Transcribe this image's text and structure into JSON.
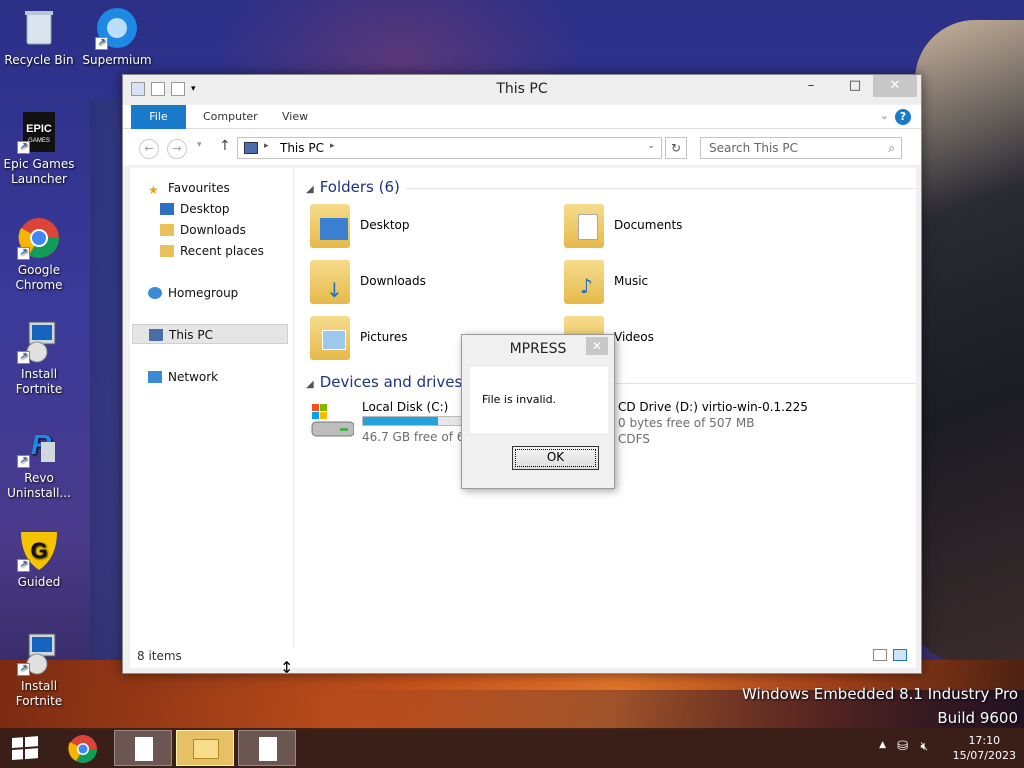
{
  "desktop": {
    "icons": [
      {
        "label": "Recycle Bin",
        "icon": "recycle-bin-icon"
      },
      {
        "label": "Supermium",
        "icon": "supermium-icon"
      },
      {
        "label": "Epic Games Launcher",
        "icon": "epic-games-icon"
      },
      {
        "label": "Google Chrome",
        "icon": "chrome-icon"
      },
      {
        "label": "Install Fortnite",
        "icon": "installer-icon"
      },
      {
        "label": "Revo Uninstall...",
        "icon": "revo-icon"
      },
      {
        "label": "Guided",
        "icon": "guilded-icon"
      },
      {
        "label": "Install Fortnite",
        "icon": "installer-icon"
      }
    ],
    "watermark_line1": "Windows Embedded 8.1 Industry Pro",
    "watermark_line2": "Build 9600"
  },
  "window": {
    "title": "This PC",
    "ribbon_tabs": [
      "File",
      "Computer",
      "View"
    ],
    "address": "This PC",
    "search_placeholder": "Search This PC",
    "nav": {
      "favourites": "Favourites",
      "favourite_items": [
        "Desktop",
        "Downloads",
        "Recent places"
      ],
      "homegroup": "Homegroup",
      "this_pc": "This PC",
      "network": "Network"
    },
    "folders_header": "Folders (6)",
    "folders": [
      "Desktop",
      "Documents",
      "Downloads",
      "Music",
      "Pictures",
      "Videos"
    ],
    "devices_header": "Devices and drives (2)",
    "drives": [
      {
        "name": "Local Disk (C:)",
        "free": "46.7 GB free of 69.6",
        "used_fraction": 0.33
      },
      {
        "name": "CD Drive (D:) virtio-win-0.1.225",
        "free": "0 bytes free of 507 MB",
        "fs": "CDFS"
      }
    ],
    "status": "8 items"
  },
  "dialog": {
    "title": "MPRESS",
    "message": "File is invalid.",
    "ok_label": "OK"
  },
  "tray": {
    "time": "17:10",
    "date": "15/07/2023"
  }
}
